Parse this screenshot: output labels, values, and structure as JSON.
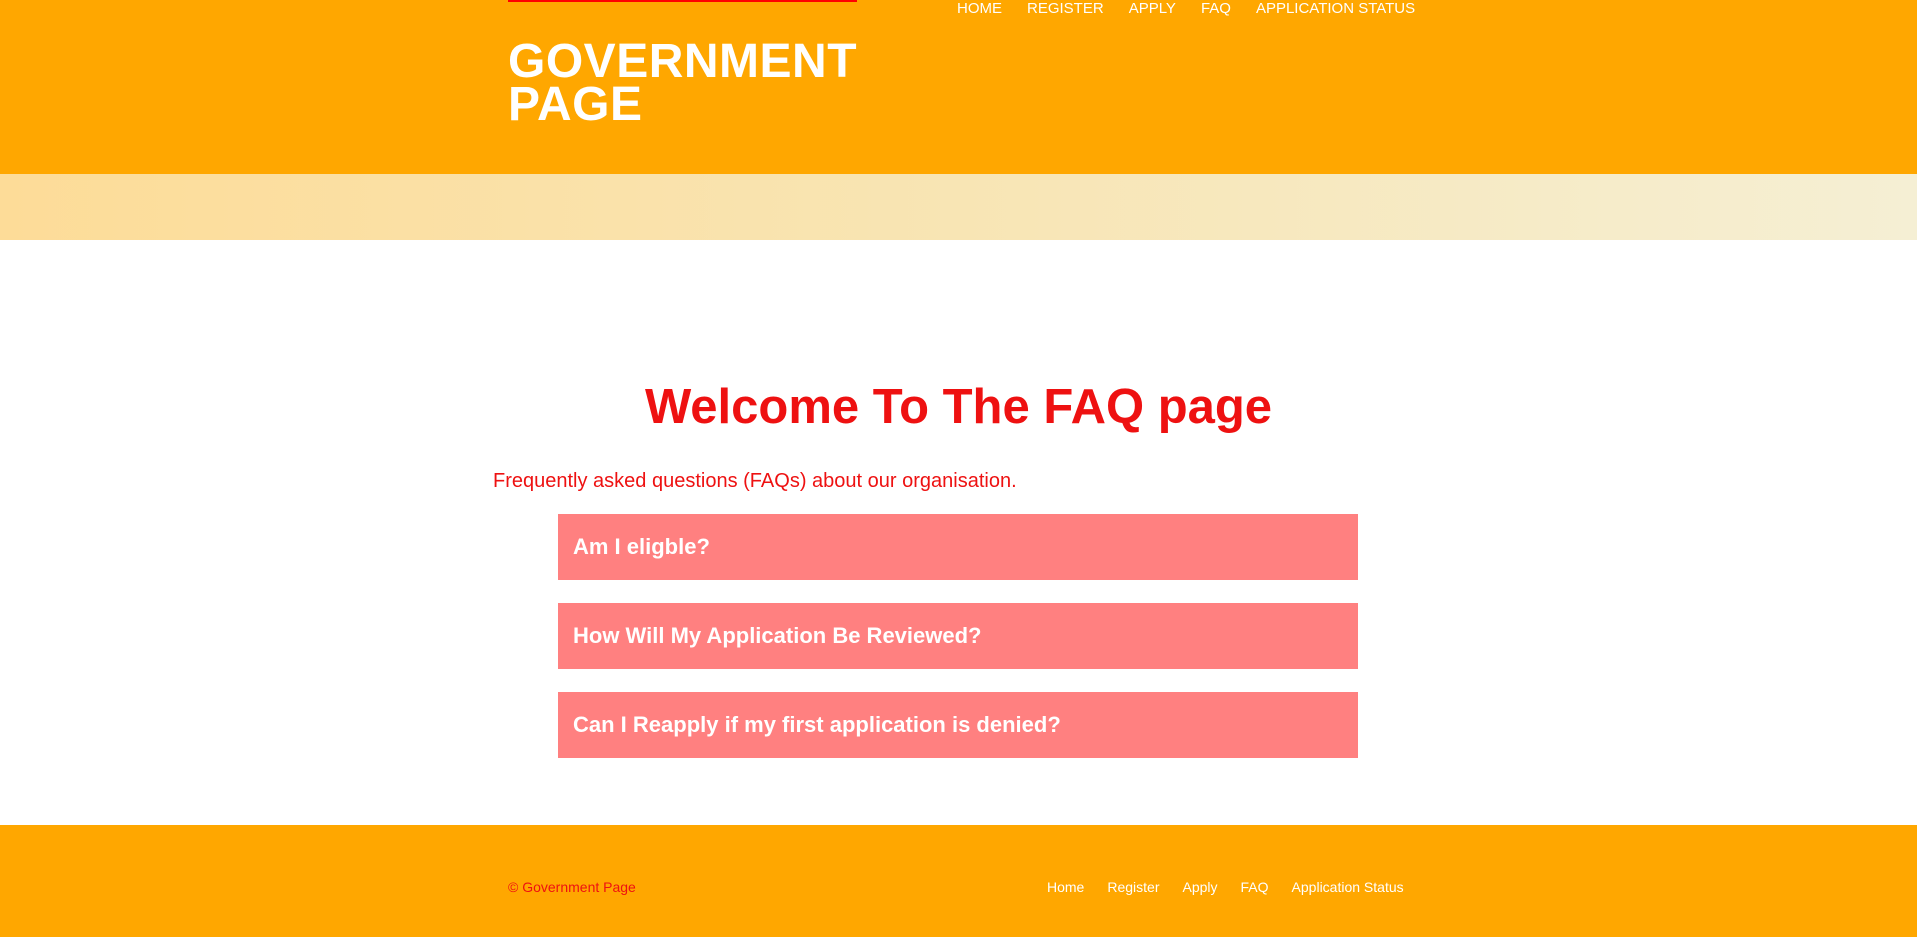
{
  "header": {
    "title_line1": "GOVERNMENT",
    "title_line2": "PAGE",
    "nav": [
      "HOME",
      "REGISTER",
      "APPLY",
      "FAQ",
      "APPLICATION STATUS"
    ]
  },
  "main": {
    "heading": "Welcome To The FAQ page",
    "intro": "Frequently asked questions (FAQs) about our organisation.",
    "faqs": [
      "Am I eligble?",
      "How Will My Application Be Reviewed?",
      "Can I Reapply if my first application is denied?"
    ]
  },
  "footer": {
    "copyright": "© Government Page",
    "nav": [
      "Home",
      "Register",
      "Apply",
      "FAQ",
      "Application Status"
    ]
  },
  "colors": {
    "header_bg": "#ffa700",
    "accent_red": "#ee1111",
    "faq_bg": "#ff8080"
  }
}
